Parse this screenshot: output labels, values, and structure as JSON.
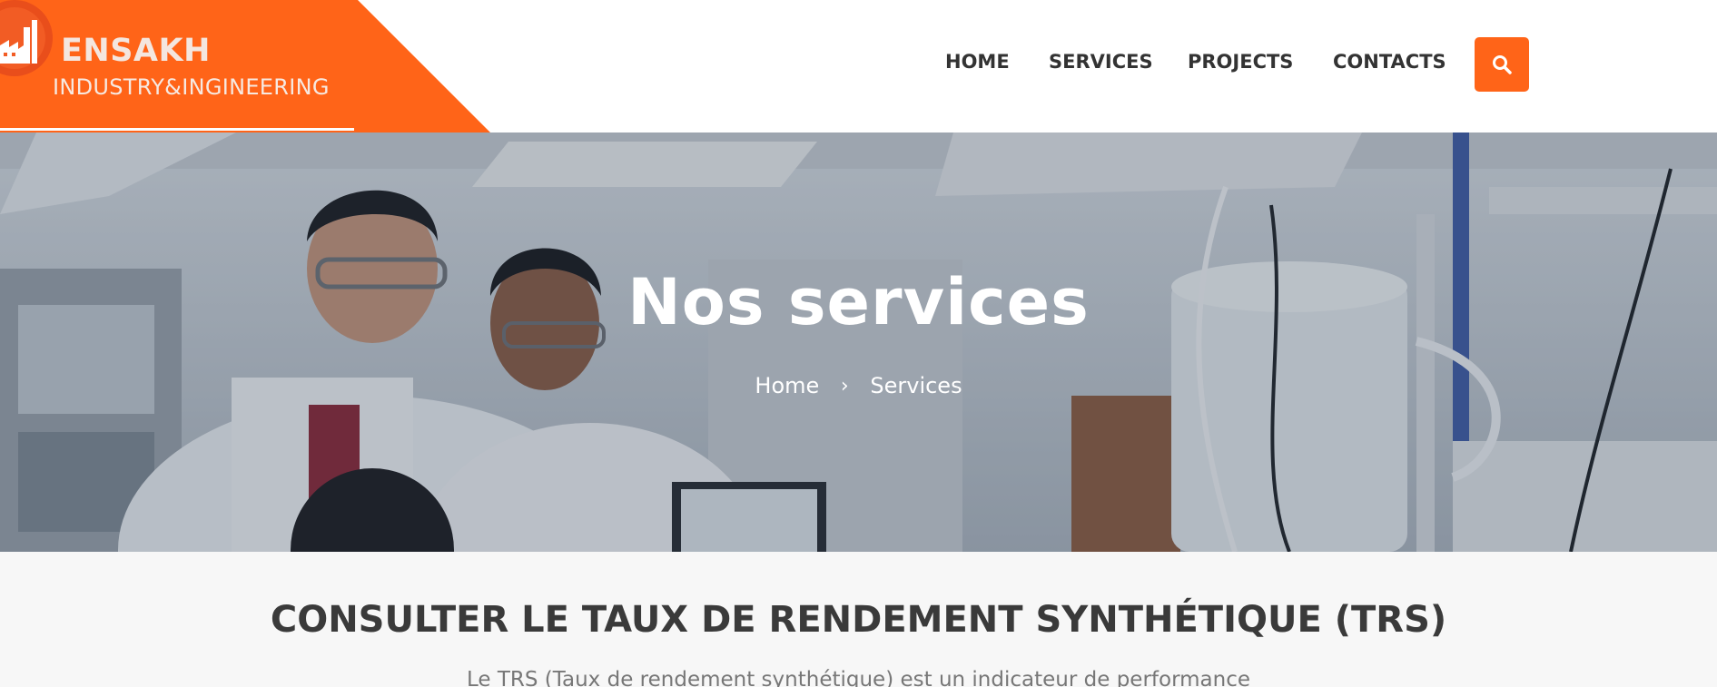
{
  "brand": {
    "name": "ENSAKH",
    "tagline": "INDUSTRY&INGINEERING",
    "accent": "#ff6418"
  },
  "nav": {
    "items": [
      {
        "label": "HOME"
      },
      {
        "label": "SERVICES"
      },
      {
        "label": "PROJECTS"
      },
      {
        "label": "CONTACTS"
      }
    ],
    "search_icon": "search-icon"
  },
  "hero": {
    "title": "Nos services",
    "breadcrumb": {
      "home": "Home",
      "separator": "›",
      "current": "Services"
    }
  },
  "section": {
    "title": "CONSULTER LE TAUX DE RENDEMENT SYNTHÉTIQUE (TRS)",
    "text": "Le TRS (Taux de rendement synthétique) est un indicateur de performance"
  }
}
